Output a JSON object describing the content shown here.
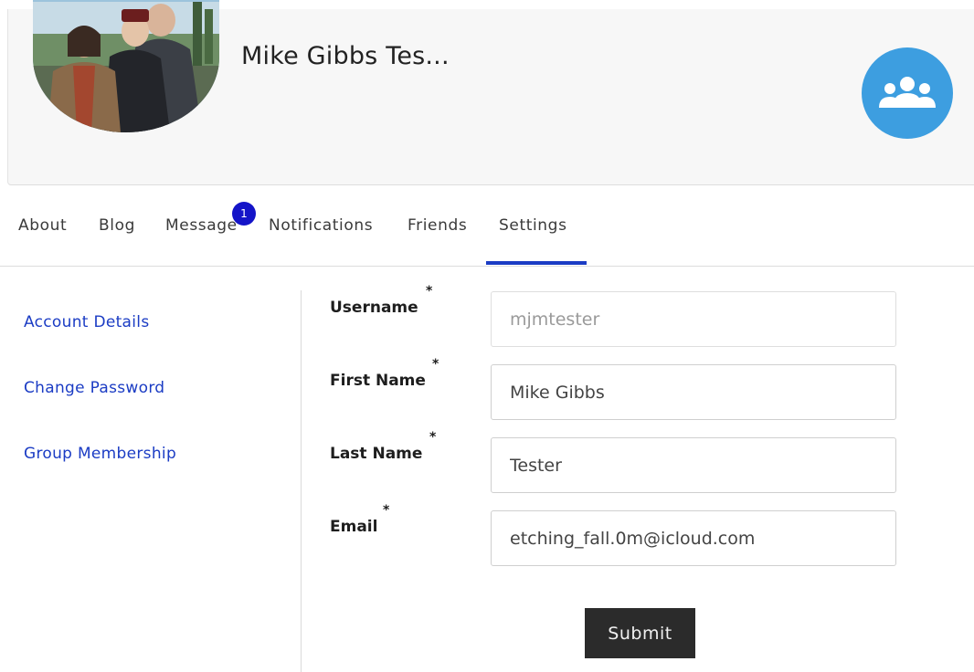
{
  "profile": {
    "name": "Mike Gibbs Tes...",
    "avatar_icon": "profile-photo",
    "group_icon": "group-icon",
    "group_button_color": "#3d9ee0"
  },
  "tabs": [
    {
      "label": "About",
      "active": false
    },
    {
      "label": "Blog",
      "active": false
    },
    {
      "label": "Message",
      "active": false,
      "badge": "1"
    },
    {
      "label": "Notifications",
      "active": false
    },
    {
      "label": "Friends",
      "active": false
    },
    {
      "label": "Settings",
      "active": true
    }
  ],
  "sidebar": {
    "items": [
      {
        "label": "Account Details"
      },
      {
        "label": "Change Password"
      },
      {
        "label": "Group Membership"
      }
    ]
  },
  "form": {
    "required_mark": "*",
    "fields": [
      {
        "label": "Username",
        "value": "mjmtester",
        "disabled": true
      },
      {
        "label": "First Name",
        "value": "Mike Gibbs",
        "disabled": false
      },
      {
        "label": "Last Name",
        "value": "Tester",
        "disabled": false
      },
      {
        "label": "Email",
        "value": "etching_fall.0m@icloud.com",
        "disabled": false
      }
    ],
    "submit_label": "Submit"
  },
  "colors": {
    "accent": "#1b3cc4",
    "badge": "#1414c8",
    "submit_bg": "#2b2b2b"
  }
}
